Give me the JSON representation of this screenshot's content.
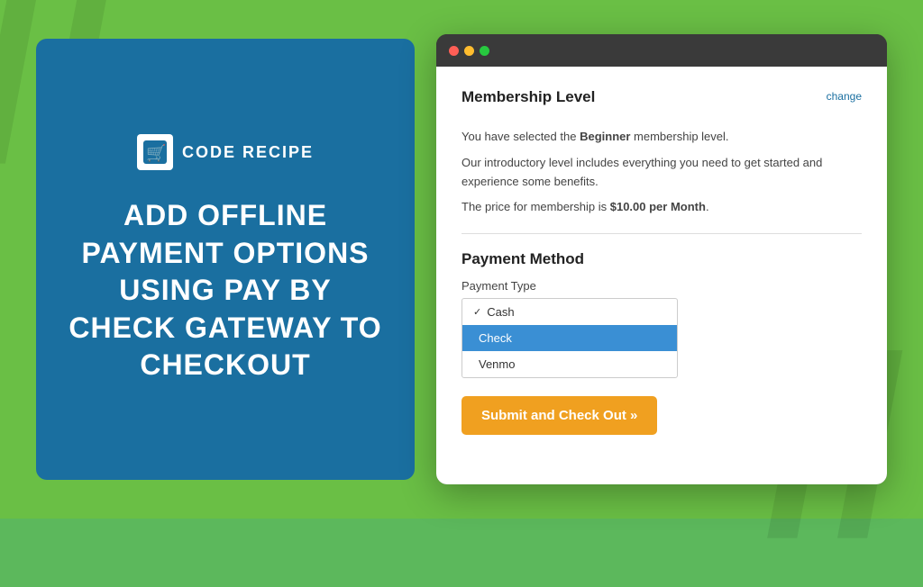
{
  "background": {
    "color": "#6abf45"
  },
  "left_panel": {
    "logo_text": "CODE RECIPE",
    "logo_icon": "🛒",
    "heading": "ADD OFFLINE PAYMENT OPTIONS USING PAY BY CHECK GATEWAY TO CHECKOUT"
  },
  "browser": {
    "membership_section": {
      "title": "Membership Level",
      "change_link": "change",
      "line1_prefix": "You have selected the ",
      "line1_bold": "Beginner",
      "line1_suffix": " membership level.",
      "line2": "Our introductory level includes everything you need to get started and experience some benefits.",
      "line3_prefix": "The price for membership is ",
      "line3_bold": "$10.00 per Month",
      "line3_suffix": "."
    },
    "payment_section": {
      "title": "Payment Method",
      "label": "Payment Type",
      "options": [
        {
          "label": "Cash",
          "checked": true,
          "selected": false
        },
        {
          "label": "Check",
          "checked": false,
          "selected": true
        },
        {
          "label": "Venmo",
          "checked": false,
          "selected": false
        }
      ]
    },
    "submit_button": {
      "label": "Submit and Check Out »"
    }
  }
}
